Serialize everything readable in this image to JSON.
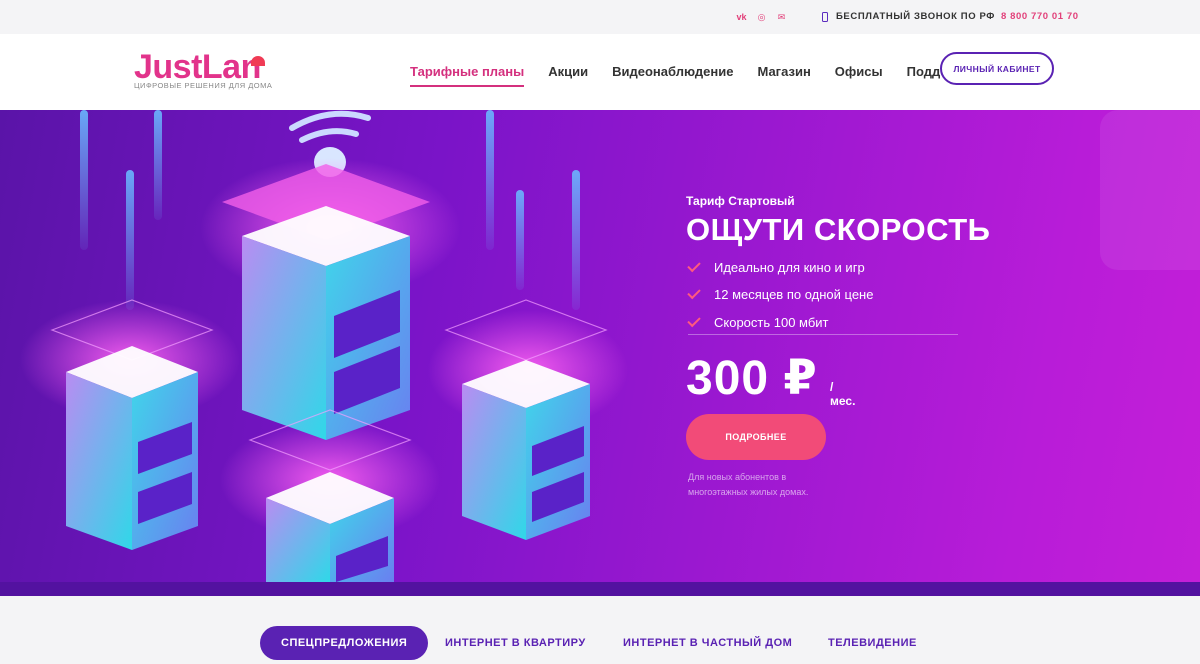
{
  "topbar": {
    "icons": [
      "vk-icon",
      "instagram-icon",
      "mail-icon"
    ],
    "free_call_label": "БЕСПЛАТНЫЙ ЗВОНОК ПО РФ",
    "phone": "8 800 770 01 70"
  },
  "header": {
    "logo_text": "JustLan",
    "logo_tagline": "ЦИФРОВЫЕ РЕШЕНИЯ ДЛЯ ДОМА",
    "nav": [
      "Тарифные планы",
      "Акции",
      "Видеонаблюдение",
      "Магазин",
      "Офисы",
      "Поддержка"
    ],
    "active_nav": "Тарифные планы",
    "cabinet_label": "ЛИЧНЫЙ КАБИНЕТ"
  },
  "hero": {
    "tariff": "Тариф Стартовый",
    "headline": "ОЩУТИ СКОРОСТЬ",
    "features": [
      "Идеально для кино и игр",
      "12 месяцев по одной цене",
      "Скорость 100 мбит"
    ],
    "price": "300 ₽",
    "per": "/мес.",
    "cta": "ПОДРОБНЕЕ",
    "note": "Для новых абонентов в многоэтажных жилых домах."
  },
  "tabs": [
    "СПЕЦПРЕДЛОЖЕНИЯ",
    "ИНТЕРНЕТ В КВАРТИРУ",
    "ИНТЕРНЕТ В ЧАСТНЫЙ ДОМ",
    "ТЕЛЕВИДЕНИЕ"
  ],
  "colors": {
    "brand_pink": "#e2338b",
    "brand_purple": "#5a22b3",
    "cta_pink": "#f24b78"
  }
}
